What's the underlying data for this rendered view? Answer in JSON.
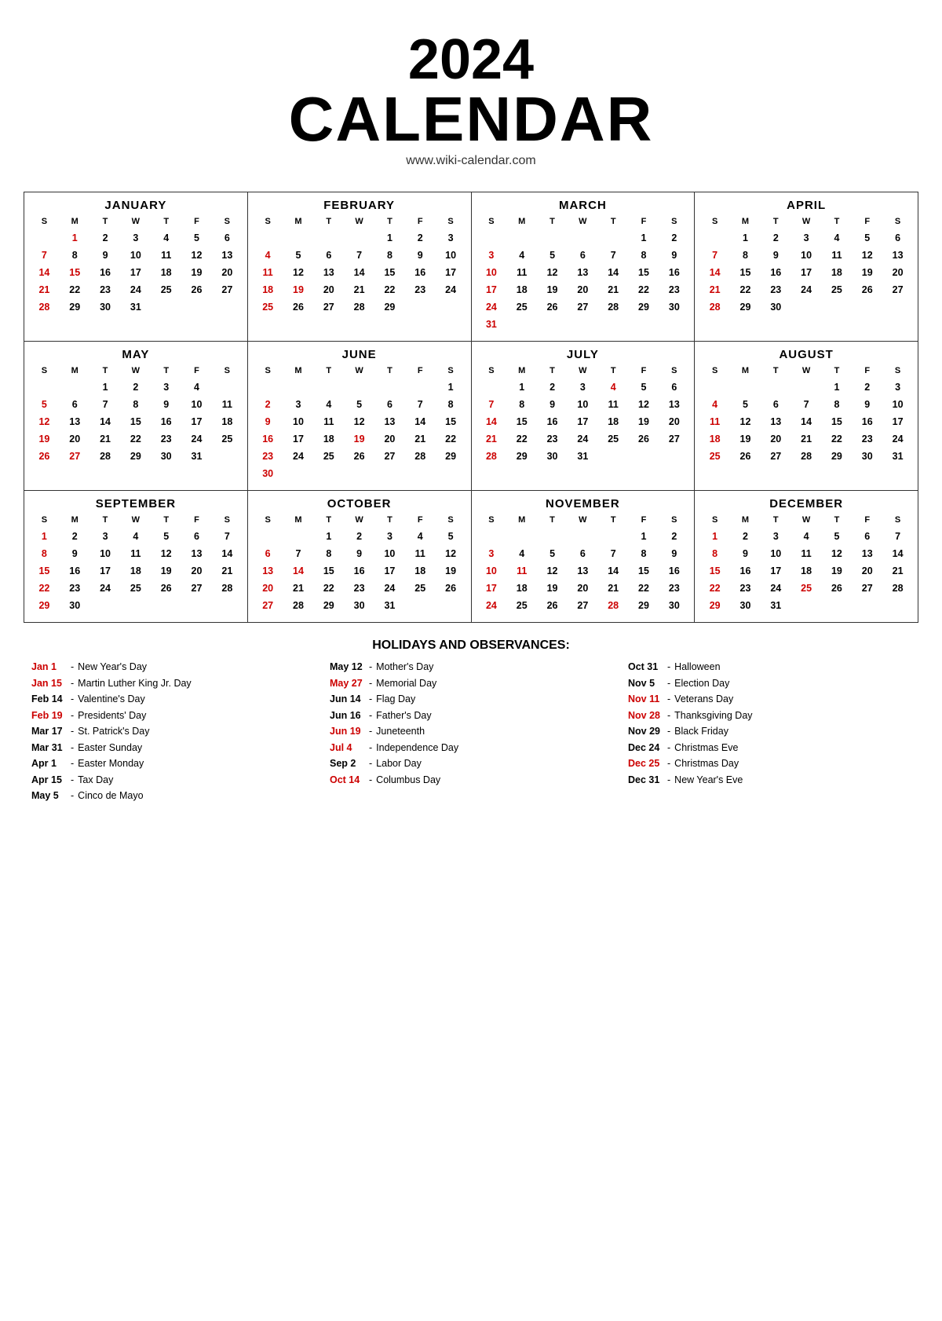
{
  "header": {
    "year": "2024",
    "title": "CALENDAR",
    "website": "www.wiki-calendar.com"
  },
  "months": [
    {
      "name": "JANUARY",
      "weeks": [
        [
          "",
          1,
          2,
          3,
          4,
          5,
          6
        ],
        [
          7,
          8,
          9,
          10,
          11,
          12,
          13
        ],
        [
          14,
          15,
          16,
          17,
          18,
          19,
          20
        ],
        [
          21,
          22,
          23,
          24,
          25,
          26,
          27
        ],
        [
          28,
          29,
          30,
          31,
          "",
          "",
          ""
        ]
      ],
      "holidays": [
        1,
        15
      ]
    },
    {
      "name": "FEBRUARY",
      "weeks": [
        [
          "",
          "",
          "",
          "",
          1,
          2,
          3
        ],
        [
          4,
          5,
          6,
          7,
          8,
          9,
          10
        ],
        [
          11,
          12,
          13,
          14,
          15,
          16,
          17
        ],
        [
          18,
          19,
          20,
          21,
          22,
          23,
          24
        ],
        [
          25,
          26,
          27,
          28,
          29,
          "",
          ""
        ]
      ],
      "holidays": [
        19
      ]
    },
    {
      "name": "MARCH",
      "weeks": [
        [
          "",
          "",
          "",
          "",
          "",
          1,
          2
        ],
        [
          3,
          4,
          5,
          6,
          7,
          8,
          9
        ],
        [
          10,
          11,
          12,
          13,
          14,
          15,
          16
        ],
        [
          17,
          18,
          19,
          20,
          21,
          22,
          23
        ],
        [
          24,
          25,
          26,
          27,
          28,
          29,
          30
        ],
        [
          31,
          "",
          "",
          "",
          "",
          "",
          ""
        ]
      ],
      "holidays": []
    },
    {
      "name": "APRIL",
      "weeks": [
        [
          "",
          1,
          2,
          3,
          4,
          5,
          6
        ],
        [
          7,
          8,
          9,
          10,
          11,
          12,
          13
        ],
        [
          14,
          15,
          16,
          17,
          18,
          19,
          20
        ],
        [
          21,
          22,
          23,
          24,
          25,
          26,
          27
        ],
        [
          28,
          29,
          30,
          "",
          "",
          "",
          ""
        ]
      ],
      "holidays": []
    },
    {
      "name": "MAY",
      "weeks": [
        [
          "",
          "",
          1,
          2,
          3,
          4,
          ""
        ],
        [
          5,
          6,
          7,
          8,
          9,
          10,
          11
        ],
        [
          12,
          13,
          14,
          15,
          16,
          17,
          18
        ],
        [
          19,
          20,
          21,
          22,
          23,
          24,
          25
        ],
        [
          26,
          27,
          28,
          29,
          30,
          31,
          ""
        ]
      ],
      "holidays": [
        27
      ]
    },
    {
      "name": "JUNE",
      "weeks": [
        [
          "",
          "",
          "",
          "",
          "",
          "",
          1
        ],
        [
          2,
          3,
          4,
          5,
          6,
          7,
          8
        ],
        [
          9,
          10,
          11,
          12,
          13,
          14,
          15
        ],
        [
          16,
          17,
          18,
          19,
          20,
          21,
          22
        ],
        [
          23,
          24,
          25,
          26,
          27,
          28,
          29
        ],
        [
          30,
          "",
          "",
          "",
          "",
          "",
          ""
        ]
      ],
      "holidays": [
        19
      ]
    },
    {
      "name": "JULY",
      "weeks": [
        [
          "",
          1,
          2,
          3,
          4,
          5,
          6
        ],
        [
          7,
          8,
          9,
          10,
          11,
          12,
          13
        ],
        [
          14,
          15,
          16,
          17,
          18,
          19,
          20
        ],
        [
          21,
          22,
          23,
          24,
          25,
          26,
          27
        ],
        [
          28,
          29,
          30,
          31,
          "",
          "",
          ""
        ]
      ],
      "holidays": [
        4
      ]
    },
    {
      "name": "AUGUST",
      "weeks": [
        [
          "",
          "",
          "",
          "",
          1,
          2,
          3
        ],
        [
          4,
          5,
          6,
          7,
          8,
          9,
          10
        ],
        [
          11,
          12,
          13,
          14,
          15,
          16,
          17
        ],
        [
          18,
          19,
          20,
          21,
          22,
          23,
          24
        ],
        [
          25,
          26,
          27,
          28,
          29,
          30,
          31
        ]
      ],
      "holidays": []
    },
    {
      "name": "SEPTEMBER",
      "weeks": [
        [
          1,
          2,
          3,
          4,
          5,
          6,
          7
        ],
        [
          8,
          9,
          10,
          11,
          12,
          13,
          14
        ],
        [
          15,
          16,
          17,
          18,
          19,
          20,
          21
        ],
        [
          22,
          23,
          24,
          25,
          26,
          27,
          28
        ],
        [
          29,
          30,
          "",
          "",
          "",
          "",
          ""
        ]
      ],
      "holidays": []
    },
    {
      "name": "OCTOBER",
      "weeks": [
        [
          "",
          "",
          1,
          2,
          3,
          4,
          5
        ],
        [
          6,
          7,
          8,
          9,
          10,
          11,
          12
        ],
        [
          13,
          14,
          15,
          16,
          17,
          18,
          19
        ],
        [
          20,
          21,
          22,
          23,
          24,
          25,
          26
        ],
        [
          27,
          28,
          29,
          30,
          31,
          "",
          ""
        ]
      ],
      "holidays": [
        14
      ]
    },
    {
      "name": "NOVEMBER",
      "weeks": [
        [
          "",
          "",
          "",
          "",
          "",
          1,
          2
        ],
        [
          3,
          4,
          5,
          6,
          7,
          8,
          9
        ],
        [
          10,
          11,
          12,
          13,
          14,
          15,
          16
        ],
        [
          17,
          18,
          19,
          20,
          21,
          22,
          23
        ],
        [
          24,
          25,
          26,
          27,
          28,
          29,
          30
        ]
      ],
      "holidays": [
        11,
        28
      ]
    },
    {
      "name": "DECEMBER",
      "weeks": [
        [
          1,
          2,
          3,
          4,
          5,
          6,
          7
        ],
        [
          8,
          9,
          10,
          11,
          12,
          13,
          14
        ],
        [
          15,
          16,
          17,
          18,
          19,
          20,
          21
        ],
        [
          22,
          23,
          24,
          25,
          26,
          27,
          28
        ],
        [
          29,
          30,
          31,
          "",
          "",
          "",
          ""
        ]
      ],
      "holidays": [
        25
      ]
    }
  ],
  "day_headers": [
    "S",
    "M",
    "T",
    "W",
    "T",
    "F",
    "S"
  ],
  "holidays_title": "HOLIDAYS AND OBSERVANCES:",
  "holidays": [
    {
      "date": "Jan 1",
      "red": true,
      "name": "New Year's Day"
    },
    {
      "date": "Jan 15",
      "red": true,
      "name": "Martin Luther King Jr. Day"
    },
    {
      "date": "Feb 14",
      "red": false,
      "name": "Valentine's Day"
    },
    {
      "date": "Feb 19",
      "red": true,
      "name": "Presidents' Day"
    },
    {
      "date": "Mar 17",
      "red": false,
      "name": "St. Patrick's Day"
    },
    {
      "date": "Mar 31",
      "red": false,
      "name": "Easter Sunday"
    },
    {
      "date": "Apr 1",
      "red": false,
      "name": "Easter Monday"
    },
    {
      "date": "Apr 15",
      "red": false,
      "name": "Tax Day"
    },
    {
      "date": "May 5",
      "red": false,
      "name": "Cinco de Mayo"
    },
    {
      "date": "May 12",
      "red": false,
      "name": "Mother's Day"
    },
    {
      "date": "May 27",
      "red": true,
      "name": "Memorial Day"
    },
    {
      "date": "Jun 14",
      "red": false,
      "name": "Flag Day"
    },
    {
      "date": "Jun 16",
      "red": false,
      "name": "Father's Day"
    },
    {
      "date": "Jun 19",
      "red": true,
      "name": "Juneteenth"
    },
    {
      "date": "Jul 4",
      "red": true,
      "name": "Independence Day"
    },
    {
      "date": "Sep 2",
      "red": false,
      "name": "Labor Day"
    },
    {
      "date": "Oct 14",
      "red": true,
      "name": "Columbus Day"
    },
    {
      "date": "Oct 31",
      "red": false,
      "name": "Halloween"
    },
    {
      "date": "Nov 5",
      "red": false,
      "name": "Election Day"
    },
    {
      "date": "Nov 11",
      "red": true,
      "name": "Veterans Day"
    },
    {
      "date": "Nov 28",
      "red": true,
      "name": "Thanksgiving Day"
    },
    {
      "date": "Nov 29",
      "red": false,
      "name": "Black Friday"
    },
    {
      "date": "Dec 24",
      "red": false,
      "name": "Christmas Eve"
    },
    {
      "date": "Dec 25",
      "red": true,
      "name": "Christmas Day"
    },
    {
      "date": "Dec 31",
      "red": false,
      "name": "New Year's Eve"
    }
  ]
}
